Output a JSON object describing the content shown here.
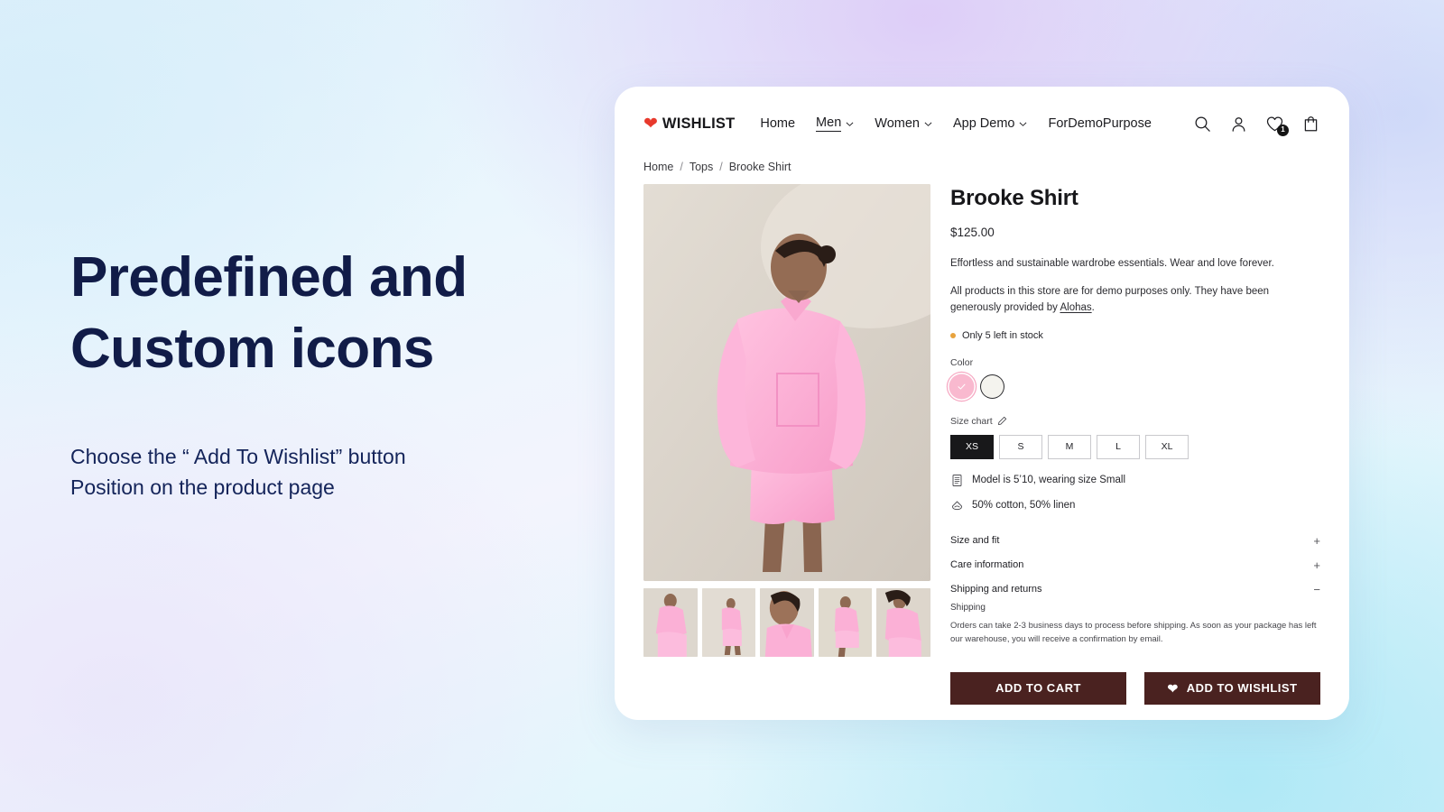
{
  "promo": {
    "title_line1": "Predefined and",
    "title_line2": "Custom icons",
    "subtitle_line1": "Choose the “ Add To Wishlist” button",
    "subtitle_line2": "Position on the product page",
    "title_color": "#111c48"
  },
  "header": {
    "brand": "WISHLIST",
    "brand_heart_icon": "heart-icon",
    "brand_heart_color": "#e8392c",
    "nav": [
      {
        "label": "Home",
        "has_chevron": false,
        "active": false
      },
      {
        "label": "Men",
        "has_chevron": true,
        "active": true
      },
      {
        "label": "Women",
        "has_chevron": true,
        "active": false
      },
      {
        "label": "App Demo",
        "has_chevron": true,
        "active": false
      },
      {
        "label": "ForDemoPurpose",
        "has_chevron": false,
        "active": false
      }
    ],
    "actions": [
      {
        "name": "search-icon"
      },
      {
        "name": "account-icon"
      },
      {
        "name": "wishlist-icon",
        "badge": "1"
      },
      {
        "name": "cart-icon"
      }
    ]
  },
  "breadcrumb": {
    "items": [
      "Home",
      "Tops",
      "Brooke Shirt"
    ],
    "separator": "/"
  },
  "product": {
    "title": "Brooke Shirt",
    "price": "$125.00",
    "description_1": "Effortless and sustainable wardrobe essentials. Wear and love forever.",
    "description_2_before": "All products in this store are for demo purposes only. They have been generously provided by ",
    "description_2_link": "Alohas",
    "description_2_after": ".",
    "stock_text": "Only 5 left in stock",
    "stock_color": "#e8a33d",
    "color_label": "Color",
    "colors": [
      {
        "name": "pink",
        "hex": "#f9b9cf",
        "selected": true
      },
      {
        "name": "cream",
        "hex": "#f4f3ee",
        "selected": false
      }
    ],
    "size_chart_label": "Size chart",
    "size_chart_icon": "pencil-icon",
    "sizes": [
      {
        "label": "XS",
        "selected": true
      },
      {
        "label": "S",
        "selected": false
      },
      {
        "label": "M",
        "selected": false
      },
      {
        "label": "L",
        "selected": false
      },
      {
        "label": "XL",
        "selected": false
      }
    ],
    "model_note": "Model is 5’10, wearing size Small",
    "model_icon": "ruler-icon",
    "material_note": "50% cotton, 50% linen",
    "material_icon": "fabric-icon",
    "accordions": [
      {
        "title": "Size and fit",
        "sign": "+",
        "open": false
      },
      {
        "title": "Care information",
        "sign": "+",
        "open": false
      },
      {
        "title": "Shipping and returns",
        "sign": "−",
        "open": true,
        "sub_title": "Shipping",
        "body": "Orders can take 2-3 business days to process before shipping. As soon as your package has left our warehouse, you will receive a confirmation by email."
      }
    ],
    "cta_primary": "ADD TO CART",
    "cta_secondary": "ADD TO WISHLIST",
    "cta_secondary_icon": "heart-icon",
    "cta_color": "#4a2220",
    "thumbnail_count": 5
  }
}
